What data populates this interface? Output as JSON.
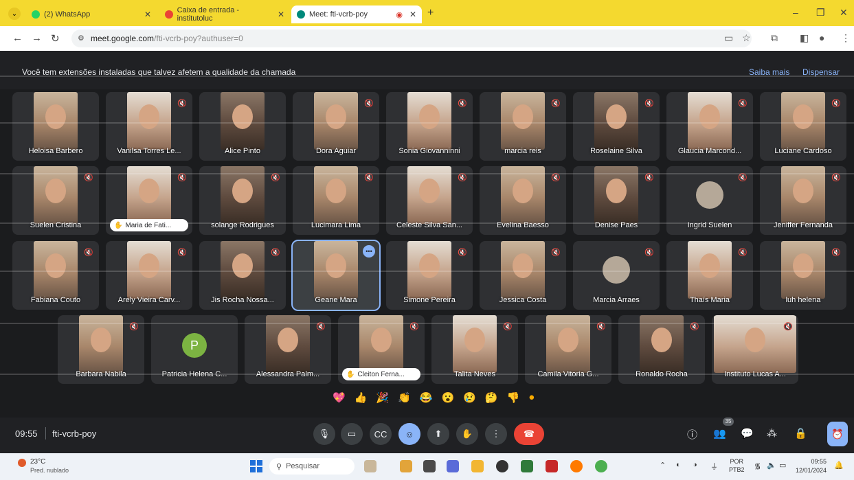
{
  "browser": {
    "tabs": [
      {
        "title": "(2) WhatsApp",
        "fav": "#25d366"
      },
      {
        "title": "Caixa de entrada - institutoluc",
        "fav": "#ea4335"
      },
      {
        "title": "Meet: fti-vcrb-poy",
        "fav": "#00897b"
      }
    ],
    "url_host": "meet.google.com",
    "url_path": "/fti-vcrb-poy?authuser=0",
    "new_tab_label": "+"
  },
  "banner": {
    "message": "Você tem extensões instaladas que talvez afetem a qualidade da chamada",
    "learn_more": "Saiba mais",
    "dismiss": "Dispensar"
  },
  "participants": [
    {
      "name": "Heloisa Barbero",
      "muted": false
    },
    {
      "name": "Vanilsa Torres Le...",
      "muted": true
    },
    {
      "name": "Alice Pinto",
      "muted": false
    },
    {
      "name": "Dora Aguiar",
      "muted": true
    },
    {
      "name": "Sonia Giovanninni",
      "muted": true
    },
    {
      "name": "marcia reis",
      "muted": true
    },
    {
      "name": "Roselaine Silva",
      "muted": true
    },
    {
      "name": "Glaucia Marcond...",
      "muted": true
    },
    {
      "name": "Luciane Cardoso",
      "muted": true
    },
    {
      "name": "Suelen Cristina",
      "muted": true
    },
    {
      "name": "Maria de Fati...",
      "muted": true,
      "hand": true
    },
    {
      "name": "solange Rodrigues",
      "muted": true
    },
    {
      "name": "Lucimara Lima",
      "muted": true
    },
    {
      "name": "Celeste Silva San...",
      "muted": true
    },
    {
      "name": "Evelina Baesso",
      "muted": true
    },
    {
      "name": "Denise Paes",
      "muted": true
    },
    {
      "name": "Ingrid Suelen",
      "muted": true,
      "avatar": true
    },
    {
      "name": "Jeniffer Fernanda",
      "muted": true
    },
    {
      "name": "Fabiana Couto",
      "muted": true
    },
    {
      "name": "Arely Vieira Carv...",
      "muted": true
    },
    {
      "name": "Jis Rocha Nossa...",
      "muted": true
    },
    {
      "name": "Geane Mara",
      "muted": false,
      "highlight": true
    },
    {
      "name": "Simone Pereira",
      "muted": true
    },
    {
      "name": "Jessica Costa",
      "muted": true
    },
    {
      "name": "Marcia Arraes",
      "muted": true,
      "avatar": true
    },
    {
      "name": "Thaís Maria",
      "muted": true
    },
    {
      "name": "luh helena",
      "muted": true
    },
    {
      "name": "Barbara Nabila",
      "muted": true
    },
    {
      "name": "Patricia Helena C...",
      "muted": false,
      "letter": "P"
    },
    {
      "name": "Alessandra Palm...",
      "muted": true
    },
    {
      "name": "Cleiton Ferna...",
      "muted": true,
      "hand": true
    },
    {
      "name": "Talita Neves",
      "muted": true
    },
    {
      "name": "Camila Vitoria G...",
      "muted": true
    },
    {
      "name": "Ronaldo Rocha",
      "muted": true
    },
    {
      "name": "Instituto Lucas A...",
      "muted": true
    }
  ],
  "reactions": [
    "💖",
    "👍",
    "🎉",
    "👏",
    "😂",
    "😮",
    "😢",
    "🤔",
    "👎",
    "●"
  ],
  "controls": {
    "time": "09:55",
    "meeting_code": "fti-vcrb-poy",
    "people_count": "35"
  },
  "taskbar": {
    "temperature": "23°C",
    "weather": "Pred. nublado",
    "search_placeholder": "Pesquisar",
    "lang_top": "POR",
    "lang_bottom": "PTB2",
    "time": "09:55",
    "date": "12/01/2024"
  }
}
